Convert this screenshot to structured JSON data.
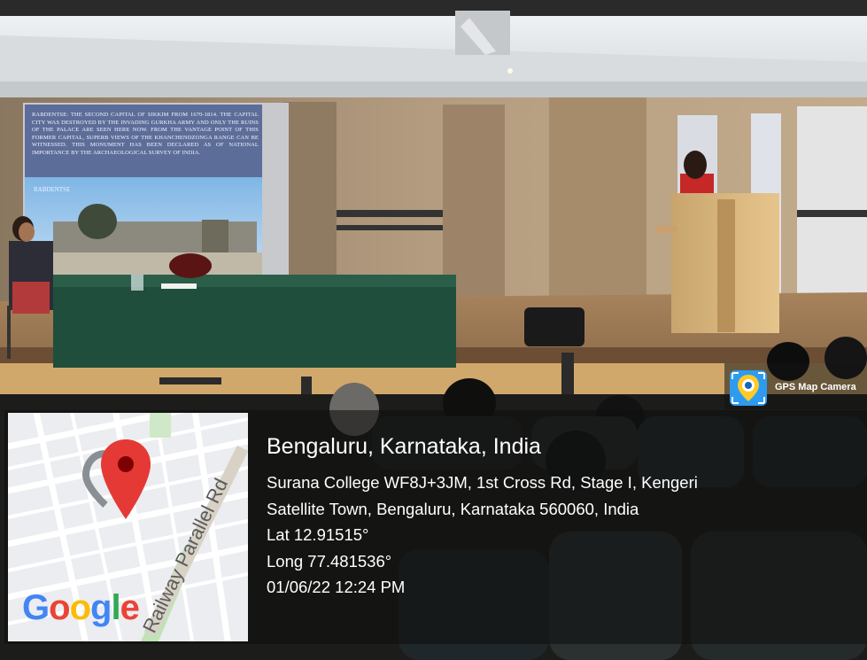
{
  "slide": {
    "body": "RABDENTSE: THE SECOND CAPITAL OF SIKKIM FROM 1670-1814. THE CAPITAL CITY WAS DESTROYED BY THE INVADING GURKHA ARMY AND ONLY THE RUINS OF THE PALACE ARE SEEN HERE NOW. FROM THE VANTAGE POINT OF THIS FORMER CAPITAL, SUPERB VIEWS OF THE KHANCHENDZONGA RANGE CAN BE WITNESSED. THIS MONUMENT HAS BEEN DECLARED AS OF NATIONAL IMPORTANCE BY THE ARCHAEOLOGICAL SURVEY OF INDIA.",
    "caption": "RABDENTSE"
  },
  "badge": {
    "label": "GPS Map Camera",
    "icon": "camera-pin-icon"
  },
  "map": {
    "road_label": "Railway Parallel Rd",
    "logo": "Google",
    "logo_colors": [
      "#4285F4",
      "#EA4335",
      "#FBBC05",
      "#4285F4",
      "#34A853",
      "#EA4335"
    ],
    "pin_color": "#E53935"
  },
  "location": {
    "title": "Bengaluru, Karnataka, India",
    "address_line1": "Surana College WF8J+3JM, 1st Cross Rd, Stage I, Kengeri",
    "address_line2": "Satellite Town, Bengaluru, Karnataka 560060, India",
    "lat": "Lat 12.91515°",
    "long": "Long 77.481536°",
    "datetime": "01/06/22 12:24 PM"
  }
}
